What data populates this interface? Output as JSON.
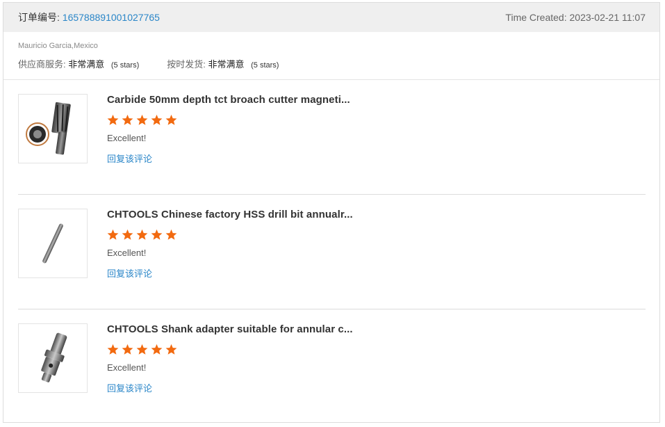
{
  "order": {
    "number_label": "订单编号:",
    "number": "165788891001027765",
    "time_created_label": "Time Created:",
    "time_created": "2023-02-21 11:07"
  },
  "buyer": "Mauricio Garcia,Mexico",
  "ratings": [
    {
      "label": "供应商服务:",
      "value": "非常满意",
      "stars": "(5 stars)"
    },
    {
      "label": "按时发货:",
      "value": "非常满意",
      "stars": "(5 stars)"
    }
  ],
  "star_color": "#f26a10",
  "items": [
    {
      "title": "Carbide 50mm depth tct broach cutter magneti...",
      "rating": 5,
      "comment": "Excellent!",
      "reply": "回复该评论",
      "image": "annular-cutter"
    },
    {
      "title": "CHTOOLS Chinese factory HSS drill bit annualr...",
      "rating": 5,
      "comment": "Excellent!",
      "reply": "回复该评论",
      "image": "pilot-pin"
    },
    {
      "title": "CHTOOLS Shank adapter suitable for annular c...",
      "rating": 5,
      "comment": "Excellent!",
      "reply": "回复该评论",
      "image": "shank-adapter"
    }
  ]
}
